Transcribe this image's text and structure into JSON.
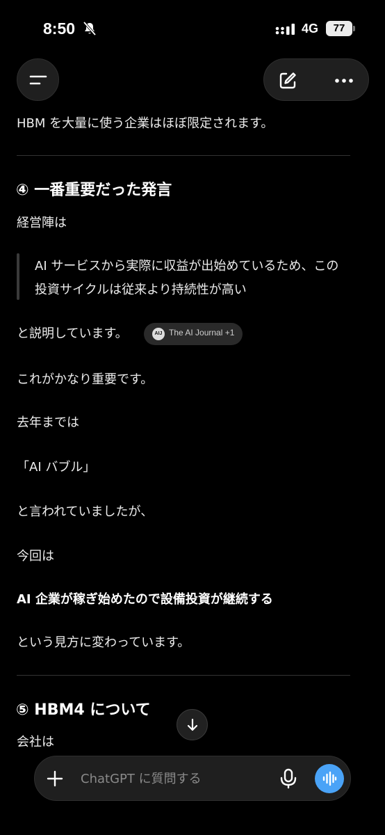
{
  "status_bar": {
    "time": "8:50",
    "network": "4G",
    "battery": "77"
  },
  "header": {
    "menu_icon": "menu-icon",
    "new_chat_icon": "edit-icon",
    "more_icon": "more-icon"
  },
  "content": {
    "intro": "HBM を大量に使う企業はほぼ限定されます。",
    "section4_title": "④ 一番重要だった発言",
    "management": "経営陣は",
    "quote_line1": "AI サービスから実際に収益が出始めているため、この",
    "quote_line2": "投資サイクルは従来より持続性が高い",
    "explained": "と説明しています。",
    "citation": {
      "icon": "AIJ",
      "label": "The AI Journal +1"
    },
    "important": "これがかなり重要です。",
    "last_year": "去年までは",
    "ai_bubble": "「AI バブル」",
    "was_said": "と言われていましたが、",
    "this_time": "今回は",
    "bold_claim": "AI 企業が稼ぎ始めたので設備投資が継続する",
    "view_change": "という見方に変わっています。",
    "section5_title": "⑤ HBM4 について",
    "company": "会社は"
  },
  "composer": {
    "placeholder": "ChatGPT に質問する",
    "accent": "#4aa3f7"
  }
}
